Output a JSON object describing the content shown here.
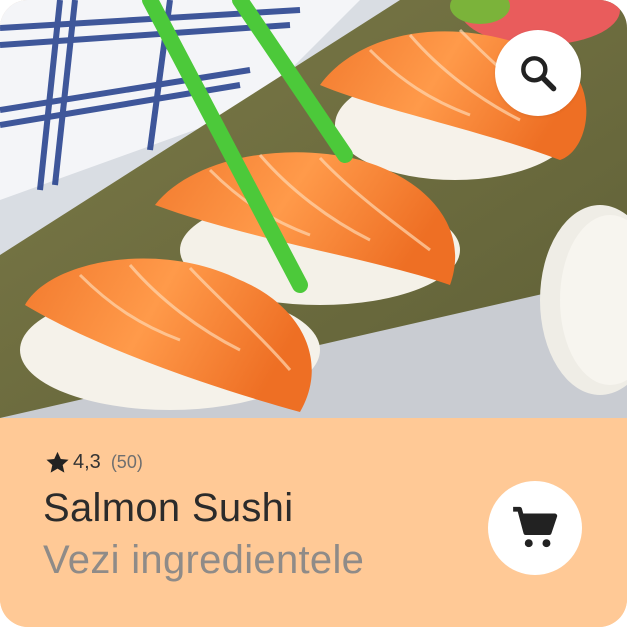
{
  "product": {
    "name": "Salmon Sushi",
    "link_text": "Vezi ingredientele",
    "rating": "4,3",
    "rating_count": "(50)",
    "image_description": "salmon-nigiri-photo"
  },
  "icons": {
    "search": "search-icon",
    "cart": "shopping-cart-icon",
    "star": "star-icon"
  },
  "colors": {
    "panel_background": "#FFC996",
    "button_background": "#FFFFFF",
    "title_text": "#2B2B2B",
    "subtitle_text": "#8F8B88",
    "icon": "#222222"
  }
}
